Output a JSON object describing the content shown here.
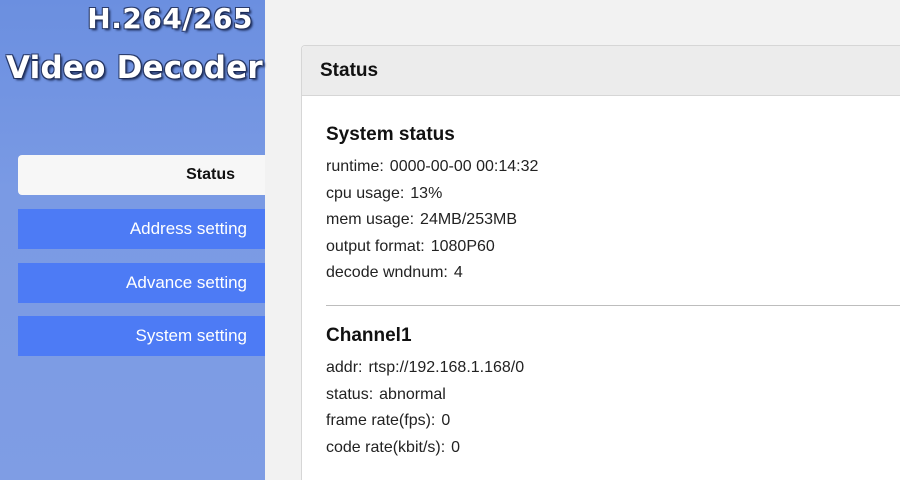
{
  "logo": {
    "line1": "H.264/265",
    "line2": "Video Decoder"
  },
  "nav": {
    "status": "Status",
    "address": "Address setting",
    "advance": "Advance setting",
    "system": "System setting"
  },
  "panel": {
    "title": "Status"
  },
  "system_status": {
    "heading": "System status",
    "runtime_label": "runtime:",
    "runtime": "0000-00-00 00:14:32",
    "cpu_label": "cpu usage:",
    "cpu": "13%",
    "mem_label": "mem usage:",
    "mem": "24MB/253MB",
    "output_label": "output format:",
    "output": "1080P60",
    "decode_label": "decode wndnum:",
    "decode": "4"
  },
  "channel1": {
    "heading": "Channel1",
    "addr_label": "addr:",
    "addr": "rtsp://192.168.1.168/0",
    "status_label": "status:",
    "status": "abnormal",
    "frame_label": "frame rate(fps):",
    "frame": "0",
    "code_label": "code rate(kbit/s):",
    "code": "0"
  },
  "colors": {
    "sidebar": "#7f9de4",
    "nav_button": "#4d7bf5",
    "active_nav": "#f7f7f7"
  }
}
